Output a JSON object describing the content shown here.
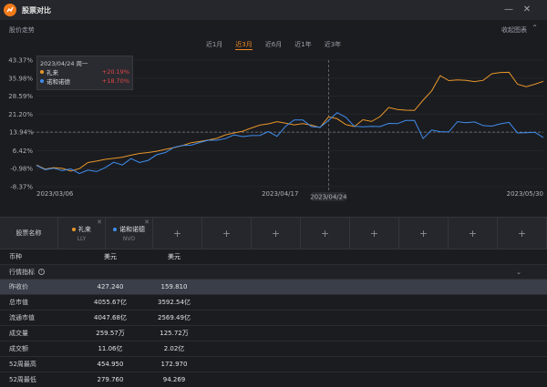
{
  "app": {
    "title": "股票对比"
  },
  "section": {
    "label": "股价走势",
    "collapse": "收起图表",
    "collapse_icon": "chevron-up"
  },
  "ranges": [
    {
      "label": "近1月",
      "active": false
    },
    {
      "label": "近3月",
      "active": true
    },
    {
      "label": "近6月",
      "active": false
    },
    {
      "label": "近1年",
      "active": false
    },
    {
      "label": "近3年",
      "active": false
    }
  ],
  "tooltip": {
    "date": "2023/04/24 周一",
    "rows": [
      {
        "name": "礼来",
        "value": "+20.19%",
        "color": "#e8962a"
      },
      {
        "name": "诺和诺德",
        "value": "+18.70%",
        "color": "#3f8ef0"
      }
    ]
  },
  "colors": {
    "lly": "#e8962a",
    "nvo": "#3f8ef0",
    "accent": "#f08a24",
    "up": "#e04848"
  },
  "chart_data": {
    "type": "line",
    "x_dates": [
      "2023/03/06",
      "2023/03/07",
      "2023/03/08",
      "2023/03/09",
      "2023/03/10",
      "2023/03/13",
      "2023/03/14",
      "2023/03/15",
      "2023/03/16",
      "2023/03/17",
      "2023/03/20",
      "2023/03/21",
      "2023/03/22",
      "2023/03/23",
      "2023/03/24",
      "2023/03/27",
      "2023/03/28",
      "2023/03/29",
      "2023/03/30",
      "2023/03/31",
      "2023/04/03",
      "2023/04/04",
      "2023/04/05",
      "2023/04/06",
      "2023/04/10",
      "2023/04/11",
      "2023/04/12",
      "2023/04/13",
      "2023/04/14",
      "2023/04/17",
      "2023/04/18",
      "2023/04/19",
      "2023/04/20",
      "2023/04/21",
      "2023/04/24",
      "2023/04/25",
      "2023/04/26",
      "2023/04/27",
      "2023/04/28",
      "2023/05/01",
      "2023/05/02",
      "2023/05/03",
      "2023/05/04",
      "2023/05/05",
      "2023/05/08",
      "2023/05/09",
      "2023/05/10",
      "2023/05/11",
      "2023/05/12",
      "2023/05/15",
      "2023/05/16",
      "2023/05/17",
      "2023/05/18",
      "2023/05/19",
      "2023/05/22",
      "2023/05/23",
      "2023/05/24",
      "2023/05/25",
      "2023/05/26",
      "2023/05/30"
    ],
    "series": [
      {
        "name": "礼来",
        "values": [
          0.5,
          -1.2,
          -0.6,
          -0.9,
          -2.0,
          -1.0,
          1.5,
          2.1,
          2.8,
          3.2,
          3.7,
          4.5,
          5.2,
          5.6,
          6.1,
          6.9,
          7.6,
          8.4,
          9.6,
          10.1,
          10.7,
          11.4,
          12.8,
          13.6,
          14.3,
          15.6,
          16.8,
          17.3,
          18.2,
          17.6,
          16.9,
          17.4,
          16.8,
          15.8,
          20.19,
          19.4,
          17.0,
          16.2,
          19.0,
          18.3,
          20.3,
          24.0,
          23.2,
          22.9,
          22.8,
          27.0,
          30.8,
          37.0,
          35.0,
          35.3,
          35.1,
          34.6,
          35.1,
          37.8,
          38.3,
          38.4,
          33.5,
          32.5,
          33.5,
          34.7
        ]
      },
      {
        "name": "诺和诺德",
        "values": [
          0.3,
          -1.4,
          -0.8,
          -1.8,
          -1.1,
          -3.0,
          -1.6,
          -2.2,
          -0.6,
          1.6,
          0.5,
          3.1,
          1.5,
          2.4,
          4.7,
          5.6,
          7.7,
          8.5,
          8.6,
          9.7,
          10.6,
          10.6,
          11.3,
          12.8,
          12.1,
          12.5,
          12.6,
          14.1,
          12.2,
          16.3,
          18.9,
          18.9,
          16.2,
          15.9,
          18.7,
          21.9,
          20.0,
          16.3,
          16.1,
          16.3,
          16.2,
          17.5,
          17.4,
          18.7,
          18.7,
          11.3,
          14.8,
          14.1,
          14.0,
          18.2,
          17.8,
          18.1,
          16.6,
          16.4,
          17.3,
          17.9,
          13.6,
          13.7,
          13.9,
          11.7
        ]
      }
    ],
    "y_ticks": [
      "43.37%",
      "35.98%",
      "28.59%",
      "21.20%",
      "13.81%",
      "6.42%",
      "-0.98%",
      "-8.37%"
    ],
    "x_ticks": [
      "2023/03/06",
      "2023/04/17",
      "2023/05/30"
    ],
    "crosshair": {
      "x_label": "2023/04/24",
      "y_label": "13.94%",
      "y_value": 13.94
    },
    "ylim": [
      -8.37,
      43.37
    ]
  },
  "table": {
    "name_header": "股票名称",
    "stocks": [
      {
        "name": "礼来",
        "code": "LLY",
        "color": "#e8962a"
      },
      {
        "name": "诺和诺德",
        "code": "NVO",
        "color": "#3f8ef0"
      }
    ],
    "add_symbol": "+",
    "currency_label": "币种",
    "currency": [
      "美元",
      "美元"
    ],
    "section": "行情指标",
    "rows": [
      {
        "label": "昨收价",
        "v1": "427.240",
        "v2": "159.810",
        "sel": true
      },
      {
        "label": "总市值",
        "v1": "4055.67亿",
        "v2": "3592.54亿",
        "sel": false
      },
      {
        "label": "流通市值",
        "v1": "4047.68亿",
        "v2": "2569.49亿",
        "sel": false
      },
      {
        "label": "成交量",
        "v1": "259.57万",
        "v2": "125.72万",
        "sel": false
      },
      {
        "label": "成交额",
        "v1": "11.06亿",
        "v2": "2.02亿",
        "sel": false
      },
      {
        "label": "52周最高",
        "v1": "454.950",
        "v2": "172.970",
        "sel": false
      },
      {
        "label": "52周最低",
        "v1": "279.760",
        "v2": "94.269",
        "sel": false
      }
    ]
  }
}
